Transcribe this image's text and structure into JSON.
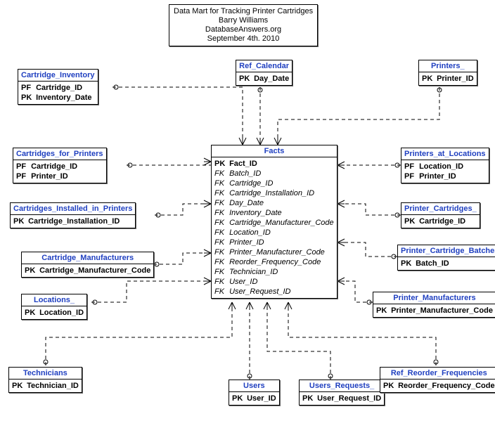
{
  "diagram_title": {
    "line1": "Data Mart for Tracking Printer Cartridges",
    "line2": "Barry Williams",
    "line3": "DatabaseAnswers.org",
    "line4": "September 4th. 2010"
  },
  "entities": {
    "facts": {
      "name": "Facts",
      "attrs": [
        {
          "kt": "PK",
          "nm": "Fact_ID",
          "fk": false
        },
        {
          "kt": "FK",
          "nm": "Batch_ID",
          "fk": true
        },
        {
          "kt": "FK",
          "nm": "Cartridge_ID",
          "fk": true
        },
        {
          "kt": "FK",
          "nm": "Cartridge_Installation_ID",
          "fk": true
        },
        {
          "kt": "FK",
          "nm": "Day_Date",
          "fk": true
        },
        {
          "kt": "FK",
          "nm": "Inventory_Date",
          "fk": true
        },
        {
          "kt": "FK",
          "nm": "Cartridge_Manufacturer_Code",
          "fk": true
        },
        {
          "kt": "FK",
          "nm": "Location_ID",
          "fk": true
        },
        {
          "kt": "FK",
          "nm": "Printer_ID",
          "fk": true
        },
        {
          "kt": "FK",
          "nm": "Printer_Manufacturer_Code",
          "fk": true
        },
        {
          "kt": "FK",
          "nm": "Reorder_Frequency_Code",
          "fk": true
        },
        {
          "kt": "FK",
          "nm": "Technician_ID",
          "fk": true
        },
        {
          "kt": "FK",
          "nm": "User_ID",
          "fk": true
        },
        {
          "kt": "FK",
          "nm": "User_Request_ID",
          "fk": true
        }
      ]
    },
    "ref_calendar": {
      "name": "Ref_Calendar",
      "attrs": [
        {
          "kt": "PK",
          "nm": "Day_Date",
          "fk": false
        }
      ]
    },
    "printers": {
      "name": "Printers_",
      "attrs": [
        {
          "kt": "PK",
          "nm": "Printer_ID",
          "fk": false
        }
      ]
    },
    "cartridge_inventory": {
      "name": "Cartridge_Inventory",
      "attrs": [
        {
          "kt": "PF",
          "nm": "Cartridge_ID",
          "fk": false
        },
        {
          "kt": "PK",
          "nm": "Inventory_Date",
          "fk": false
        }
      ]
    },
    "cartridges_for_printers": {
      "name": "Cartridges_for_Printers",
      "attrs": [
        {
          "kt": "PF",
          "nm": "Cartridge_ID",
          "fk": false
        },
        {
          "kt": "PF",
          "nm": "Printer_ID",
          "fk": false
        }
      ]
    },
    "cartridges_installed": {
      "name": "Cartridges_Installed_in_Printers",
      "attrs": [
        {
          "kt": "PK",
          "nm": "Cartridge_Installation_ID",
          "fk": false
        }
      ]
    },
    "cartridge_manufacturers": {
      "name": "Cartridge_Manufacturers",
      "attrs": [
        {
          "kt": "PK",
          "nm": "Cartridge_Manufacturer_Code",
          "fk": false
        }
      ]
    },
    "locations": {
      "name": "Locations_",
      "attrs": [
        {
          "kt": "PK",
          "nm": "Location_ID",
          "fk": false
        }
      ]
    },
    "technicians": {
      "name": "Technicians",
      "attrs": [
        {
          "kt": "PK",
          "nm": "Technician_ID",
          "fk": false
        }
      ]
    },
    "users": {
      "name": "Users",
      "attrs": [
        {
          "kt": "PK",
          "nm": "User_ID",
          "fk": false
        }
      ]
    },
    "users_requests": {
      "name": "Users_Requests_",
      "attrs": [
        {
          "kt": "PK",
          "nm": "User_Request_ID",
          "fk": false
        }
      ]
    },
    "printers_at_locations": {
      "name": "Printers_at_Locations",
      "attrs": [
        {
          "kt": "PF",
          "nm": "Location_ID",
          "fk": false
        },
        {
          "kt": "PF",
          "nm": "Printer_ID",
          "fk": false
        }
      ]
    },
    "printer_cartridges": {
      "name": "Printer_Cartridges_",
      "attrs": [
        {
          "kt": "PK",
          "nm": "Cartridge_ID",
          "fk": false
        }
      ]
    },
    "printer_cartridge_batches": {
      "name": "Printer_Cartridge_Batches",
      "attrs": [
        {
          "kt": "PK",
          "nm": "Batch_ID",
          "fk": false
        }
      ]
    },
    "printer_manufacturers": {
      "name": "Printer_Manufacturers",
      "attrs": [
        {
          "kt": "PK",
          "nm": "Printer_Manufacturer_Code",
          "fk": false
        }
      ]
    },
    "ref_reorder": {
      "name": "Ref_Reorder_Frequencies",
      "attrs": [
        {
          "kt": "PK",
          "nm": "Reorder_Frequency_Code",
          "fk": false
        }
      ]
    }
  }
}
